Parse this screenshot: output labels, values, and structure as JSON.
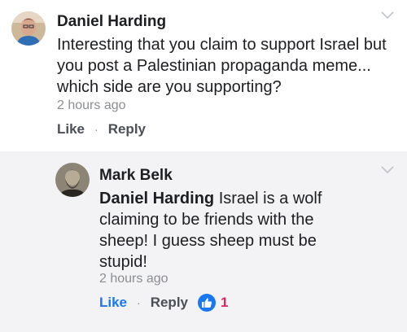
{
  "comments": [
    {
      "author": "Daniel Harding",
      "avatar_icon": "profile-photo",
      "text": "Interesting that you claim to support Israel but you post a Palestinian propaganda meme... which side are you supporting?",
      "time": "2 hours ago",
      "actions": {
        "like": "Like",
        "separator": "·",
        "reply": "Reply"
      }
    },
    {
      "author": "Mark Belk",
      "avatar_icon": "profile-photo",
      "mention": "Daniel Harding",
      "text": " Israel is a wolf claiming to be friends with the sheep! I guess sheep must be stupid!",
      "time": "2 hours ago",
      "actions": {
        "like": "Like",
        "separator": "·",
        "reply": "Reply"
      },
      "reaction": {
        "icon": "thumbs-up-icon",
        "count": "1"
      }
    }
  ],
  "colors": {
    "accent": "#1877f2",
    "reaction_count": "#e0245e",
    "reply_background": "#f3f3f5",
    "timestamp": "#8a8d91"
  }
}
